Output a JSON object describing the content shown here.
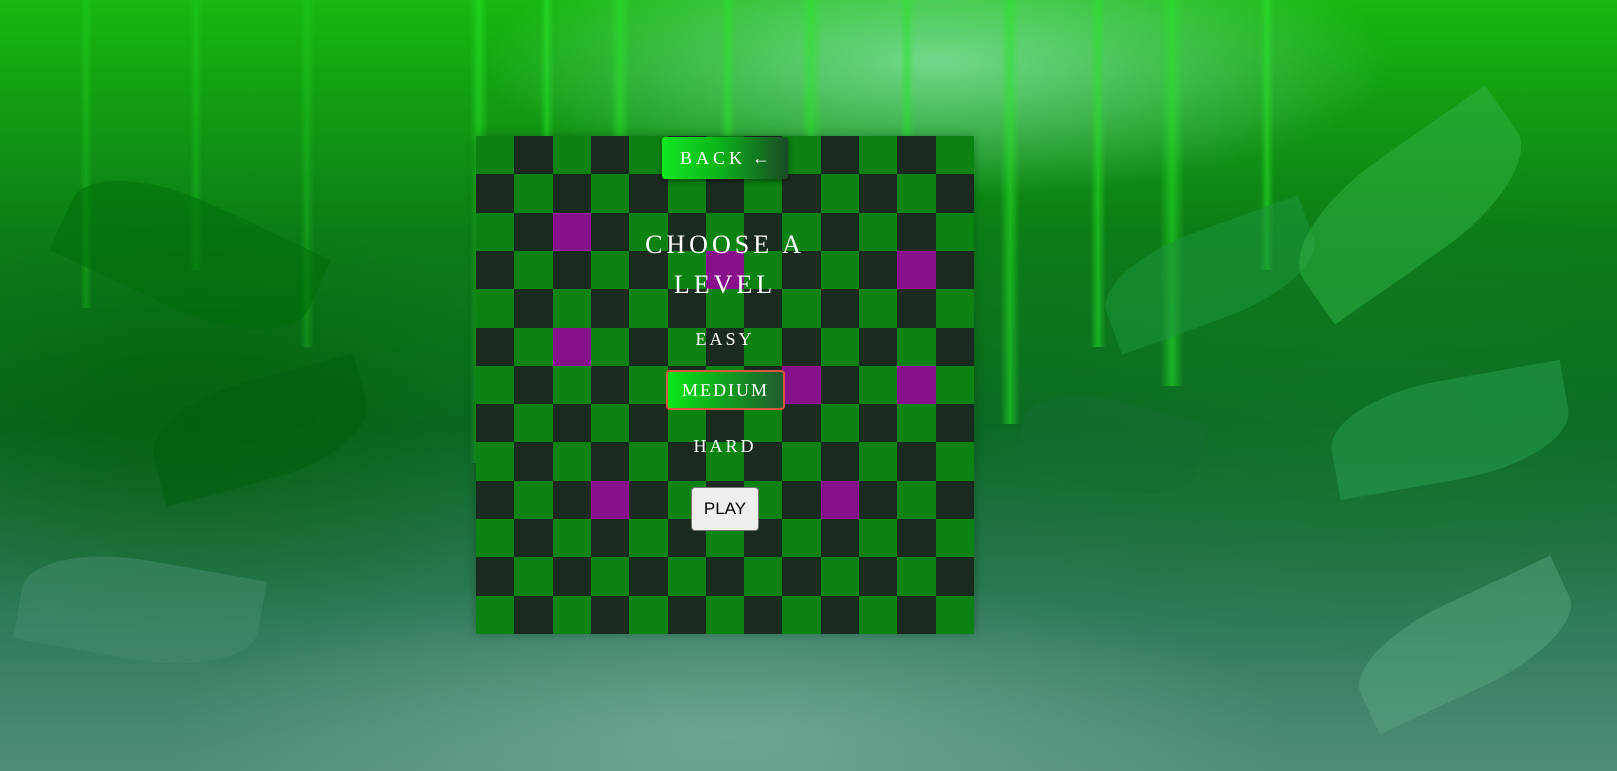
{
  "theme": {
    "board_light": "#0b8211",
    "board_dark": "#1b2a1e",
    "board_highlight": "#87108b",
    "accent": "#11e822",
    "selected_border": "#d9573f"
  },
  "board": {
    "size": 13,
    "highlight_cells": [
      [
        2,
        2
      ],
      [
        3,
        6
      ],
      [
        3,
        11
      ],
      [
        5,
        2
      ],
      [
        6,
        8
      ],
      [
        6,
        11
      ],
      [
        9,
        3
      ],
      [
        9,
        9
      ]
    ]
  },
  "nav": {
    "back_label": "BACK",
    "back_icon": "left-arrow-icon",
    "back_arrow": "←"
  },
  "menu": {
    "title": "CHOOSE A LEVEL",
    "levels": [
      "EASY",
      "MEDIUM",
      "HARD"
    ],
    "selected_level": "MEDIUM",
    "play_label": "PLAY"
  }
}
